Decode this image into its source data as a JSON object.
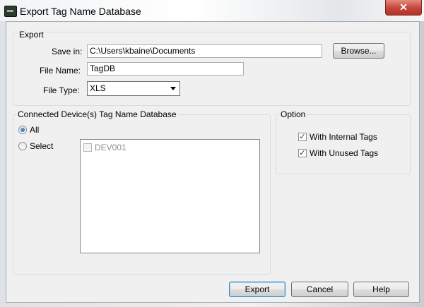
{
  "window": {
    "title": "Export Tag Name Database",
    "close_glyph": "✕"
  },
  "export_group": {
    "label": "Export",
    "save_in_label": "Save in:",
    "save_in_value": "C:\\Users\\kbaine\\Documents",
    "browse_label": "Browse...",
    "file_name_label": "File Name:",
    "file_name_value": "TagDB",
    "file_type_label": "File Type:",
    "file_type_value": "XLS"
  },
  "devices_group": {
    "label": "Connected Device(s) Tag Name Database",
    "all_label": "All",
    "all_selected": true,
    "select_label": "Select",
    "devices": [
      {
        "name": "DEV001",
        "checked": false
      }
    ]
  },
  "option_group": {
    "label": "Option",
    "with_internal_tags_label": "With Internal Tags",
    "with_internal_tags_checked": true,
    "with_unused_tags_label": "With Unused Tags",
    "with_unused_tags_checked": true,
    "check_glyph": "✓"
  },
  "buttons": {
    "export": "Export",
    "cancel": "Cancel",
    "help": "Help"
  },
  "icons": {
    "app": "app-icon",
    "close": "close-icon",
    "dropdown": "chevron-down-icon"
  }
}
